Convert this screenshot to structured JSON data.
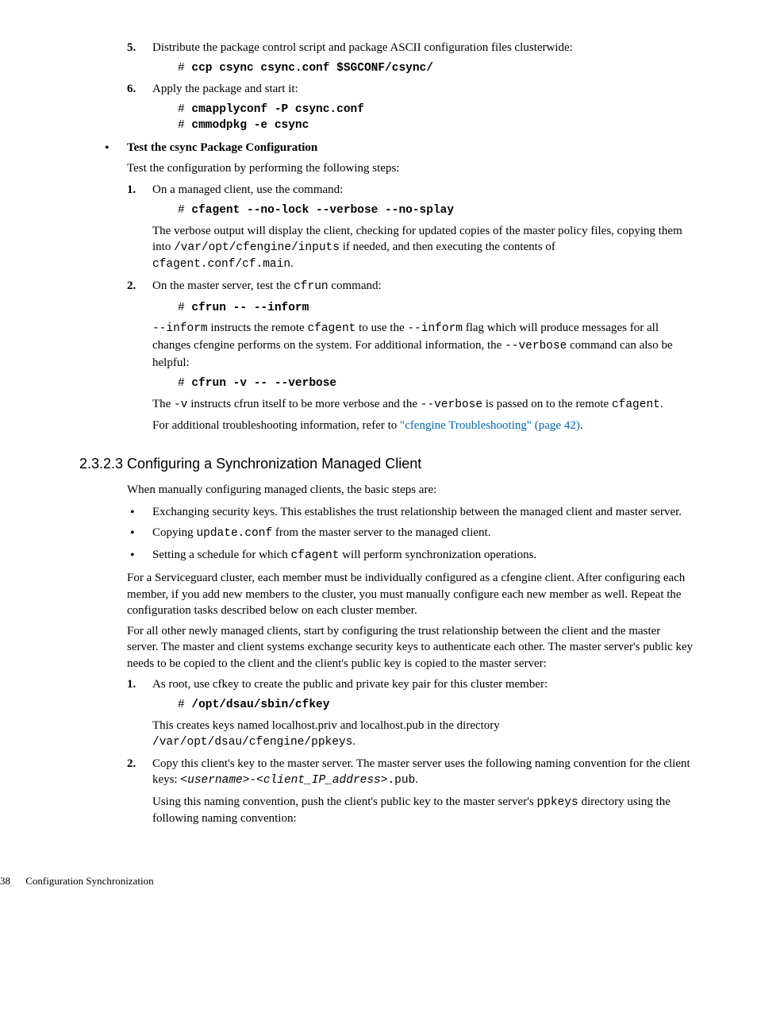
{
  "step5": {
    "num": "5.",
    "text": "Distribute the package control script and package ASCII configuration files clusterwide:",
    "cmd_prefix": "# ",
    "cmd": "ccp csync csync.conf $SGCONF/csync/"
  },
  "step6": {
    "num": "6.",
    "text": "Apply the package and start it:",
    "cmd_prefix1": "# ",
    "cmd1": "cmapplyconf -P csync.conf",
    "cmd_prefix2": "# ",
    "cmd2": "cmmodpkg -e csync"
  },
  "test_section": {
    "title": "Test the csync Package Configuration",
    "intro": "Test the configuration by performing the following steps:",
    "s1": {
      "num": "1.",
      "text": "On a managed client, use the command:",
      "cmd_prefix": "# ",
      "cmd": "cfagent --no-lock --verbose --no-splay",
      "p_a": "The verbose output will display the client, checking for updated copies of the master policy files, copying them into ",
      "p_path": "/var/opt/cfengine/inputs",
      "p_b": " if needed, and then executing the contents of ",
      "p_path2": "cfagent.conf/cf.main",
      "p_c": "."
    },
    "s2": {
      "num": "2.",
      "t_a": "On the master server, test the ",
      "t_cmd": "cfrun",
      "t_b": " command:",
      "cmd1_prefix": "# ",
      "cmd1": "cfrun -- --inform",
      "p1_a": "--inform",
      "p1_b": " instructs the remote ",
      "p1_c": "cfagent",
      "p1_d": " to use the ",
      "p1_e": "--inform",
      "p1_f": " flag which will produce messages for all changes cfengine performs on the system. For additional information, the ",
      "p1_g": "--verbose",
      "p1_h": " command can also be helpful:",
      "cmd2_prefix": "# ",
      "cmd2": "cfrun -v -- --verbose",
      "p2_a": "The ",
      "p2_b": "-v",
      "p2_c": " instructs cfrun itself to be more verbose and the ",
      "p2_d": "--verbose",
      "p2_e": " is passed on to the remote ",
      "p2_f": "cfagent",
      "p2_g": ".",
      "p3_a": "For additional troubleshooting information, refer to ",
      "p3_link": "\"cfengine Troubleshooting\" (page 42)",
      "p3_b": "."
    }
  },
  "section_2323": {
    "heading": "2.3.2.3 Configuring a Synchronization Managed Client",
    "intro": "When manually configuring managed clients, the basic steps are:",
    "b1": "Exchanging  security keys. This establishes the trust relationship between the managed client and master server.",
    "b2_a": "Copying ",
    "b2_code": "update.conf",
    "b2_b": " from the master server to the managed client.",
    "b3_a": "Setting a schedule for which ",
    "b3_code": "cfagent",
    "b3_b": " will perform synchronization operations.",
    "p1": "For a Serviceguard cluster, each member must be individually configured as a cfengine client. After configuring each member, if you add new members to the cluster, you must manually configure each new member as well. Repeat the configuration tasks described below on each cluster member.",
    "p2": "For all other newly managed clients, start by configuring the trust relationship between the client and the master server. The master and client systems exchange security keys to authenticate each other. The master server's public key needs to be copied to the client and the client's public key is copied to the master server:",
    "s1": {
      "num": "1.",
      "text": "As root, use cfkey to create the public and private key pair for this cluster member:",
      "cmd_prefix": "# ",
      "cmd": "/opt/dsau/sbin/cfkey",
      "p_a": "This creates keys named localhost.priv and localhost.pub in the directory ",
      "p_path": "/var/opt/dsau/cfengine/ppkeys",
      "p_b": "."
    },
    "s2": {
      "num": "2.",
      "t_a": "Copy this client's key to the master server. The master server uses the following naming convention for the client keys: ",
      "t_code": "<username>-<client_IP_address>",
      "t_b": ".pub",
      "t_c": ".",
      "p_a": "Using this naming convention, push the client's public key to the master server's ",
      "p_code": "ppkeys",
      "p_b": " directory using the following naming convention:"
    }
  },
  "footer": {
    "page": "38",
    "title": "Configuration Synchronization"
  }
}
